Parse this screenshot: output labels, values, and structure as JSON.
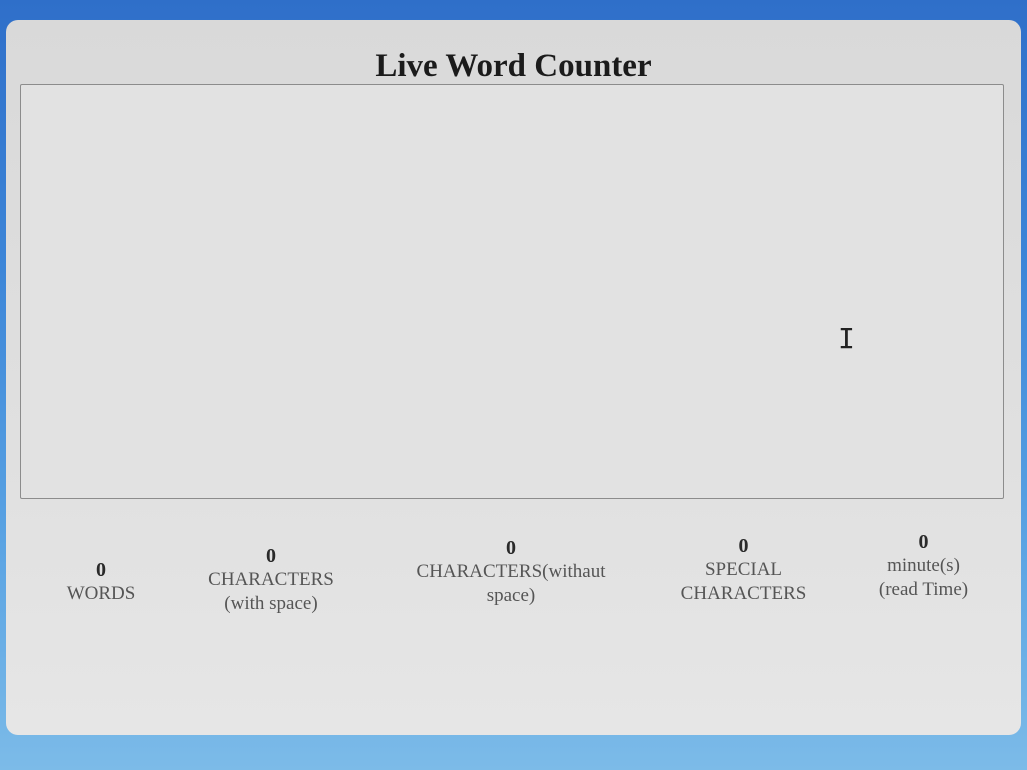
{
  "app": {
    "title": "Live Word Counter"
  },
  "editor": {
    "value": "",
    "cursor_glyph": "I"
  },
  "stats": [
    {
      "value": "0",
      "label_line1": "WORDS",
      "label_line2": ""
    },
    {
      "value": "0",
      "label_line1": "CHARACTERS",
      "label_line2": "(with space)"
    },
    {
      "value": "0",
      "label_line1": "CHARACTERS(withaut",
      "label_line2": "space)"
    },
    {
      "value": "0",
      "label_line1": "SPECIAL",
      "label_line2": "CHARACTERS"
    },
    {
      "value": "0",
      "label_line1": "minute(s)",
      "label_line2": "(read Time)"
    }
  ],
  "colors": {
    "background_top": "#2f6fc9",
    "background_bottom": "#7cbbe8",
    "panel": "#e0e0e0",
    "title_text": "#1b1b1b",
    "label_text": "#555555"
  }
}
